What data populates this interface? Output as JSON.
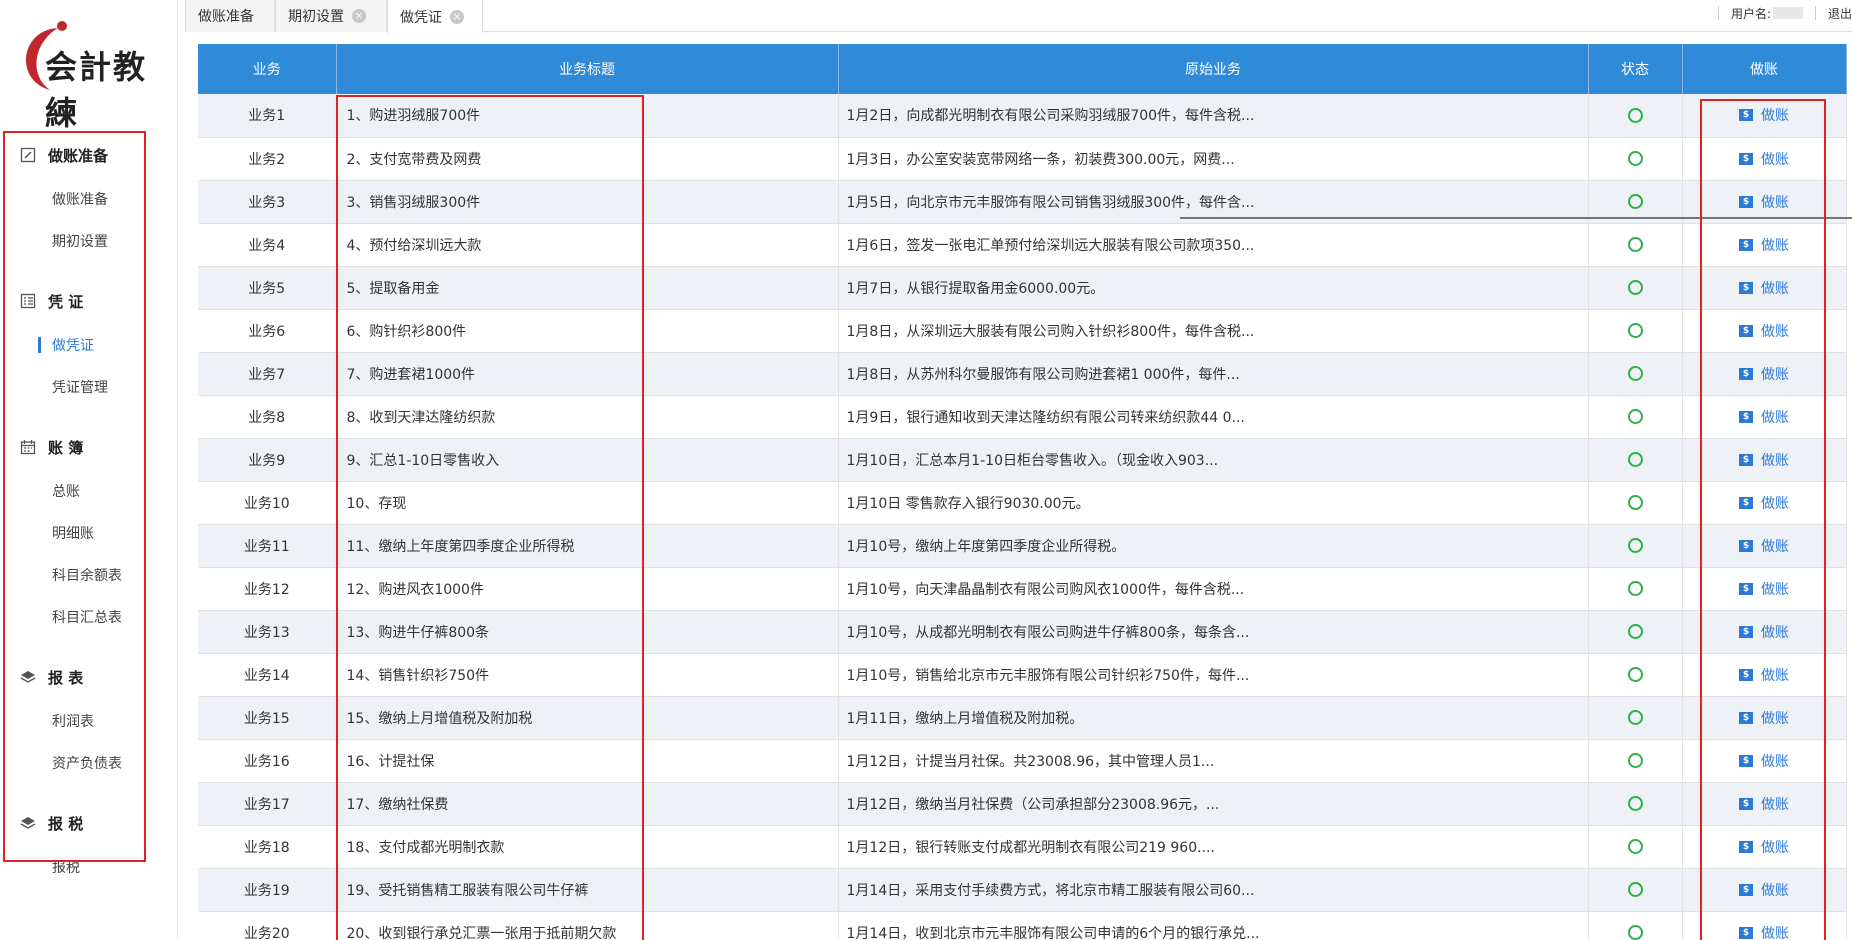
{
  "logo": {
    "text": "会計教練"
  },
  "sidebar": {
    "groups": [
      {
        "label": "做账准备",
        "icon": "edit-icon",
        "items": [
          "做账准备",
          "期初设置"
        ]
      },
      {
        "label": "凭 证",
        "icon": "list-icon",
        "items": [
          "做凭证",
          "凭证管理"
        ]
      },
      {
        "label": "账 簿",
        "icon": "calendar-icon",
        "items": [
          "总账",
          "明细账",
          "科目余额表",
          "科目汇总表"
        ]
      },
      {
        "label": "报 表",
        "icon": "layers-icon",
        "items": [
          "利润表",
          "资产负债表"
        ]
      },
      {
        "label": "报 税",
        "icon": "layers-icon",
        "items": [
          "报税"
        ]
      }
    ],
    "active_item": "做凭证"
  },
  "tabs": [
    {
      "label": "做账准备",
      "closable": false
    },
    {
      "label": "期初设置",
      "closable": true
    },
    {
      "label": "做凭证",
      "closable": true,
      "active": true
    }
  ],
  "user": {
    "name_label": "用户名:",
    "logout_label": "退出"
  },
  "table": {
    "columns": [
      "业务",
      "业务标题",
      "原始业务",
      "状态",
      "做账"
    ],
    "action_label": "做账",
    "rows": [
      {
        "id": "业务1",
        "title": "1、购进羽绒服700件",
        "desc": "1月2日，向成都光明制衣有限公司采购羽绒服700件，每件含税..."
      },
      {
        "id": "业务2",
        "title": "2、支付宽带费及网费",
        "desc": "1月3日，办公室安装宽带网络一条，初装费300.00元，网费..."
      },
      {
        "id": "业务3",
        "title": "3、销售羽绒服300件",
        "desc": "1月5日，向北京市元丰服饰有限公司销售羽绒服300件，每件含..."
      },
      {
        "id": "业务4",
        "title": "4、预付给深圳远大款",
        "desc": "1月6日，签发一张电汇单预付给深圳远大服装有限公司款项350..."
      },
      {
        "id": "业务5",
        "title": "5、提取备用金",
        "desc": "1月7日，从银行提取备用金6000.00元。"
      },
      {
        "id": "业务6",
        "title": "6、购针织衫800件",
        "desc": "1月8日，从深圳远大服装有限公司购入针织衫800件，每件含税..."
      },
      {
        "id": "业务7",
        "title": "7、购进套裙1000件",
        "desc": "1月8日，从苏州科尔曼服饰有限公司购进套裙1 000件，每件..."
      },
      {
        "id": "业务8",
        "title": "8、收到天津达隆纺织款",
        "desc": "1月9日，银行通知收到天津达隆纺织有限公司转来纺织款44 0..."
      },
      {
        "id": "业务9",
        "title": "9、汇总1-10日零售收入",
        "desc": "1月10日，汇总本月1-10日柜台零售收入。（现金收入903..."
      },
      {
        "id": "业务10",
        "title": "10、存现",
        "desc": "1月10日 零售款存入银行9030.00元。"
      },
      {
        "id": "业务11",
        "title": "11、缴纳上年度第四季度企业所得税",
        "desc": "1月10号，缴纳上年度第四季度企业所得税。"
      },
      {
        "id": "业务12",
        "title": "12、购进风衣1000件",
        "desc": "1月10号，向天津晶晶制衣有限公司购风衣1000件，每件含税..."
      },
      {
        "id": "业务13",
        "title": "13、购进牛仔裤800条",
        "desc": "1月10号，从成都光明制衣有限公司购进牛仔裤800条，每条含..."
      },
      {
        "id": "业务14",
        "title": "14、销售针织衫750件",
        "desc": "1月10号，销售给北京市元丰服饰有限公司针织衫750件，每件..."
      },
      {
        "id": "业务15",
        "title": "15、缴纳上月增值税及附加税",
        "desc": "1月11日，缴纳上月增值税及附加税。"
      },
      {
        "id": "业务16",
        "title": "16、计提社保",
        "desc": "1月12日，计提当月社保。共23008.96，其中管理人员1..."
      },
      {
        "id": "业务17",
        "title": "17、缴纳社保费",
        "desc": "1月12日，缴纳当月社保费（公司承担部分23008.96元，..."
      },
      {
        "id": "业务18",
        "title": "18、支付成都光明制衣款",
        "desc": "1月12日，银行转账支付成都光明制衣有限公司219 960...."
      },
      {
        "id": "业务19",
        "title": "19、受托销售精工服装有限公司牛仔裤",
        "desc": "1月14日，采用支付手续费方式，将北京市精工服装有限公司60..."
      },
      {
        "id": "业务20",
        "title": "20、收到银行承兑汇票一张用于抵前期欠款",
        "desc": "1月14日，收到北京市元丰服饰有限公司申请的6个月的银行承兑..."
      }
    ]
  },
  "colors": {
    "header_bg": "#2f8ad8",
    "accent": "#2c7ad6",
    "status_ok": "#2fb04a",
    "annotation": "#e02222"
  }
}
